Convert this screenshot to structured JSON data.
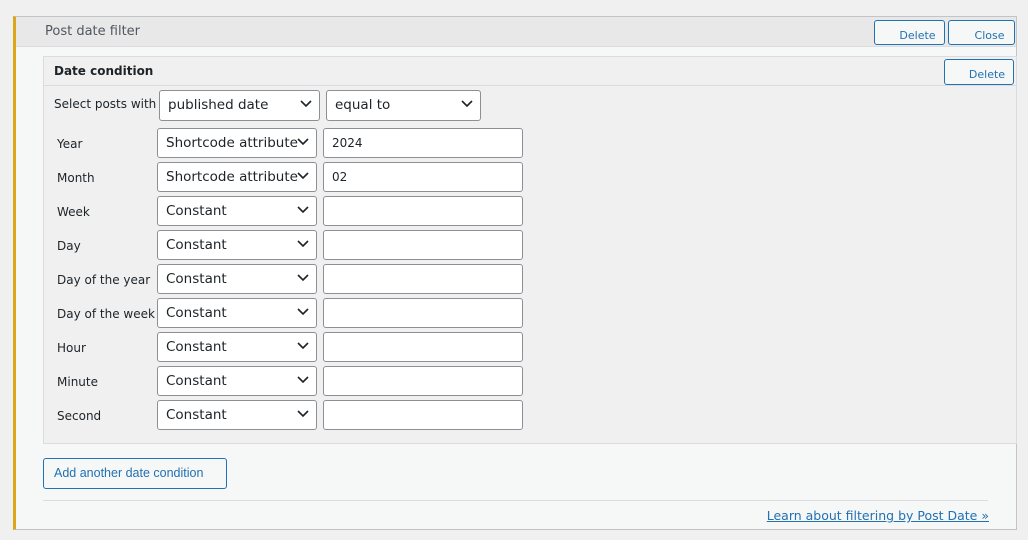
{
  "panel": {
    "title": "Post date filter",
    "delete_label": "Delete",
    "close_label": "Close"
  },
  "condition": {
    "title": "Date condition",
    "delete_label": "Delete",
    "select_posts_label": "Select posts with",
    "date_field": "published date",
    "comparison": "equal to",
    "rows": [
      {
        "label": "Year",
        "source": "Shortcode attribute",
        "value": "2024"
      },
      {
        "label": "Month",
        "source": "Shortcode attribute",
        "value": "02"
      },
      {
        "label": "Week",
        "source": "Constant",
        "value": ""
      },
      {
        "label": "Day",
        "source": "Constant",
        "value": ""
      },
      {
        "label": "Day of the year",
        "source": "Constant",
        "value": ""
      },
      {
        "label": "Day of the week",
        "source": "Constant",
        "value": ""
      },
      {
        "label": "Hour",
        "source": "Constant",
        "value": ""
      },
      {
        "label": "Minute",
        "source": "Constant",
        "value": ""
      },
      {
        "label": "Second",
        "source": "Constant",
        "value": ""
      }
    ]
  },
  "add_condition_label": "Add another date condition",
  "learn_link": "Learn about filtering by Post Date »",
  "colors": {
    "accent": "#2271b1",
    "panel_border_left": "#dba617"
  },
  "icons": {
    "dropdown": "chevron-down-icon"
  }
}
